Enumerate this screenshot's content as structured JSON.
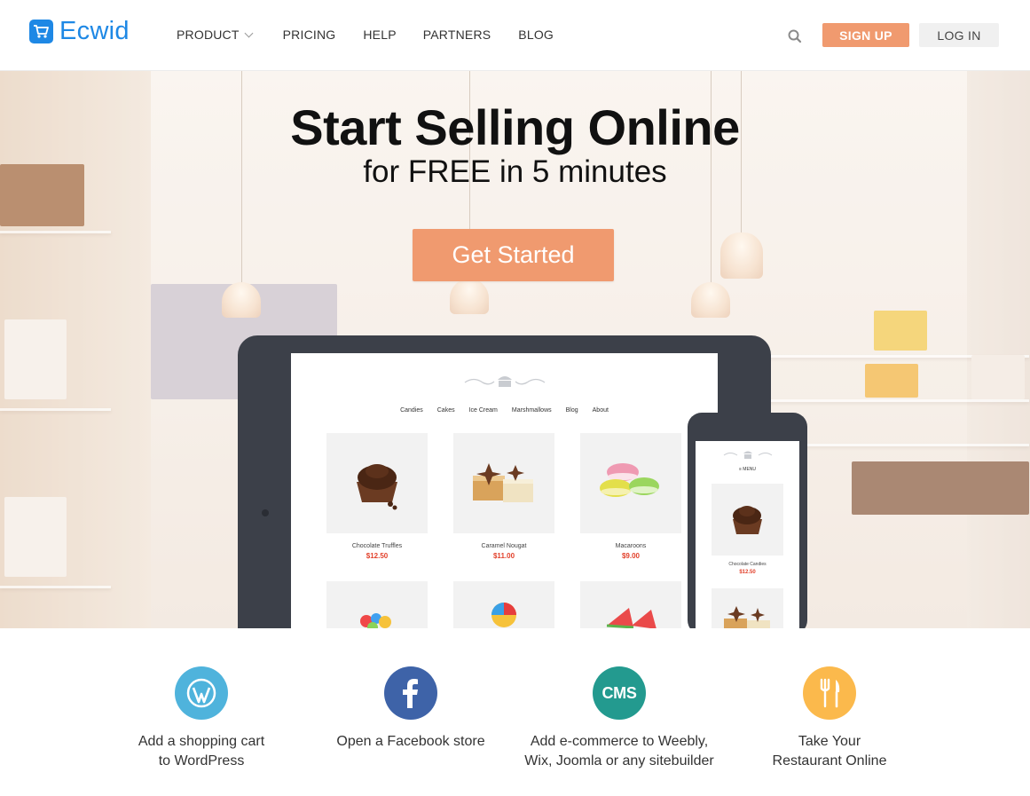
{
  "header": {
    "logo_text": "Ecwid",
    "nav": [
      {
        "label": "PRODUCT",
        "has_dropdown": true
      },
      {
        "label": "PRICING"
      },
      {
        "label": "HELP"
      },
      {
        "label": "PARTNERS"
      },
      {
        "label": "BLOG"
      }
    ],
    "search_icon": "search-icon",
    "signup_label": "SIGN UP",
    "login_label": "LOG IN"
  },
  "hero": {
    "title": "Start Selling Online",
    "subtitle": "for FREE in 5 minutes",
    "cta_label": "Get Started"
  },
  "store_preview": {
    "nav": [
      "Candies",
      "Cakes",
      "Ice Cream",
      "Marshmallows",
      "Blog",
      "About"
    ],
    "products": [
      {
        "name": "Chocolate Truffles",
        "price": "$12.50"
      },
      {
        "name": "Caramel Nougat",
        "price": "$11.00"
      },
      {
        "name": "Macaroons",
        "price": "$9.00"
      }
    ],
    "mobile_menu_label": "≡ MENU",
    "mobile_product": {
      "name": "Chocolate Candies",
      "price": "$12.50"
    }
  },
  "features": [
    {
      "icon": "wordpress-icon",
      "color": "#4fb3dc",
      "line1": "Add a shopping cart",
      "line2": "to WordPress"
    },
    {
      "icon": "facebook-icon",
      "color": "#3e63a8",
      "line1": "Open a Facebook store",
      "line2": ""
    },
    {
      "icon": "cms-icon",
      "color": "#239a8f",
      "line1": "Add e-commerce to Weebly,",
      "line2": "Wix, Joomla or any sitebuilder",
      "icon_text": "CMS"
    },
    {
      "icon": "fork-knife-icon",
      "color": "#fbb94c",
      "line1": "Take Your",
      "line2": "Restaurant Online"
    }
  ],
  "colors": {
    "brand": "#1e88e5",
    "accent": "#f09a6f",
    "price": "#e2412b"
  }
}
